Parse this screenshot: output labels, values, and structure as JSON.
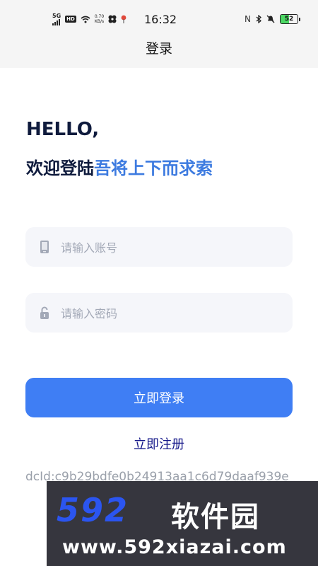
{
  "status_bar": {
    "network": "5G",
    "hd": "HD",
    "speed_value": "0.70",
    "speed_unit": "KB/s",
    "time": "16:32",
    "battery_level": "52",
    "colors": {
      "battery_fill": "#4cd964"
    }
  },
  "header": {
    "title": "登录"
  },
  "greeting": {
    "hello": "HELLO,",
    "welcome_prefix": "欢迎登陆",
    "app_name": "吾将上下而求索"
  },
  "form": {
    "account": {
      "placeholder": "请输入账号",
      "value": "",
      "icon": "phone-icon"
    },
    "password": {
      "placeholder": "请输入密码",
      "value": "",
      "icon": "lock-icon"
    },
    "login_label": "立即登录",
    "register_label": "立即注册"
  },
  "device_id": "dcId:c9b29bdfe0b24913aa1c6d79daaf939e",
  "watermark": {
    "brand": "592",
    "brand_cn": "软件园",
    "url": "www.592xiazai.com"
  },
  "colors": {
    "accent": "#3d7be0",
    "primary_button": "#3f7ef4",
    "heading": "#0f1b3d",
    "link": "#16198a"
  }
}
